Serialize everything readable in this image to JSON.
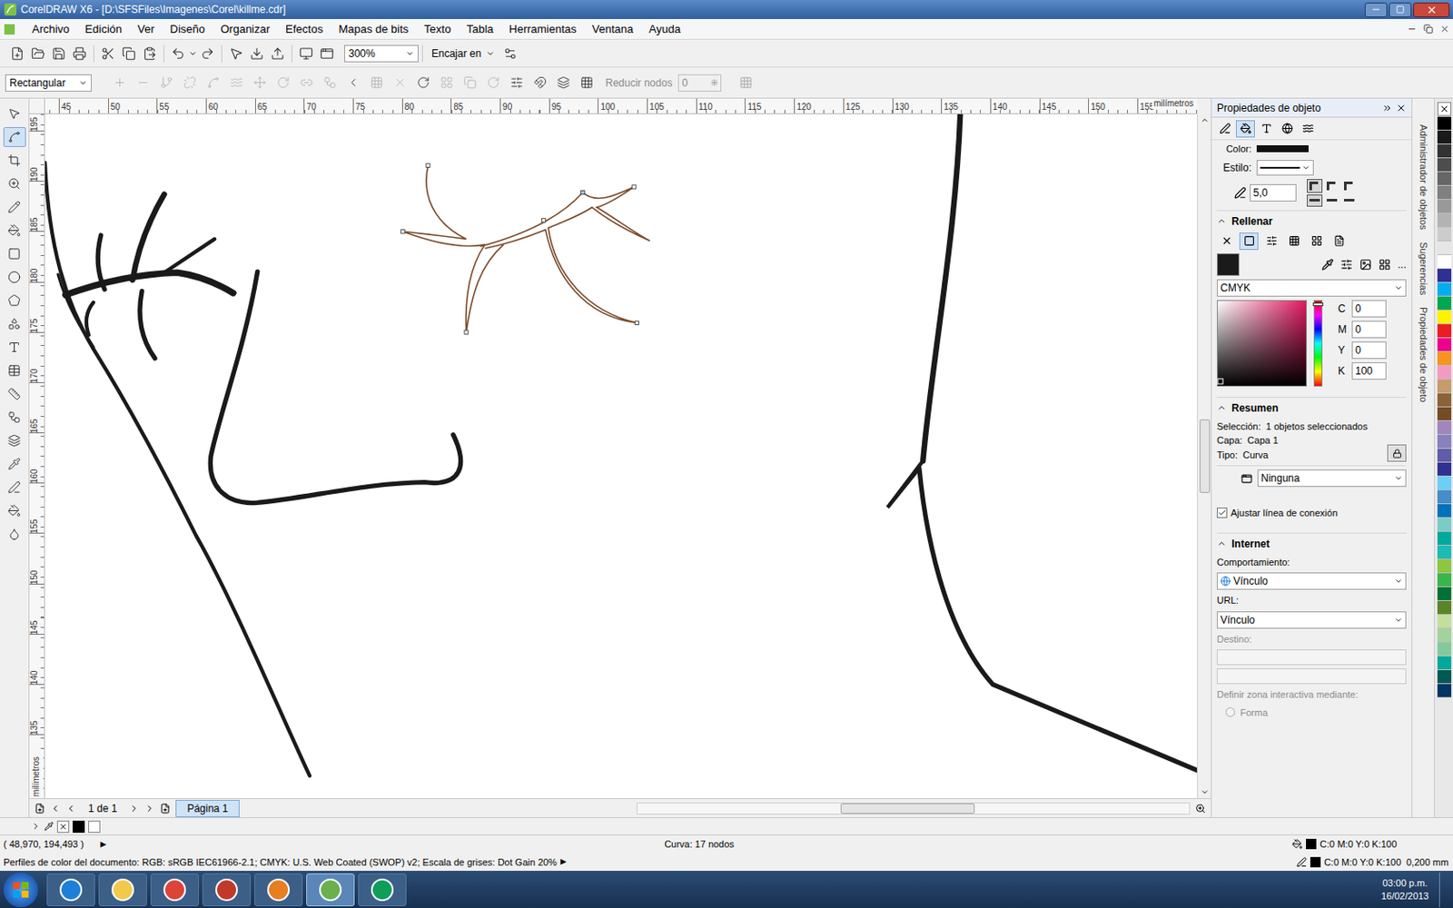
{
  "window": {
    "title": "CorelDRAW X6 - [D:\\SFSFiles\\Imagenes\\Corel\\killme.cdr]"
  },
  "menu": [
    "Archivo",
    "Edición",
    "Ver",
    "Diseño",
    "Organizar",
    "Efectos",
    "Mapas de bits",
    "Texto",
    "Tabla",
    "Herramientas",
    "Ventana",
    "Ayuda"
  ],
  "toolbar": {
    "zoom": "300%",
    "snap": "Encajar en"
  },
  "property_bar": {
    "selection_mode": "Rectangular",
    "reduce_nodes_label": "Reducir nodos",
    "reduce_nodes_value": "0",
    "buttons": [
      {
        "disabled": true
      },
      {
        "disabled": true
      },
      {
        "disabled": true
      },
      {
        "disabled": true
      },
      {
        "disabled": true
      },
      {
        "disabled": true
      },
      {
        "disabled": true
      },
      {
        "disabled": true
      },
      {
        "disabled": true
      },
      {
        "disabled": true
      },
      {
        "disabled": false
      },
      {
        "disabled": true
      },
      {
        "disabled": true
      },
      {
        "disabled": false
      },
      {
        "disabled": true
      },
      {
        "disabled": true
      },
      {
        "disabled": true
      },
      {
        "disabled": false
      },
      {
        "disabled": false
      },
      {
        "disabled": false
      },
      {
        "disabled": false
      }
    ]
  },
  "rulers": {
    "unit": "milímetros",
    "top": [
      "45",
      "50",
      "55",
      "60",
      "65",
      "70",
      "75",
      "80",
      "85",
      "90",
      "95",
      "100",
      "105",
      "110",
      "115",
      "120",
      "125",
      "130",
      "135",
      "140",
      "145",
      "150",
      "155"
    ],
    "left": [
      "195",
      "190",
      "185",
      "180",
      "175",
      "170",
      "165",
      "160",
      "155",
      "150",
      "145",
      "140",
      "135"
    ]
  },
  "toolbox": [
    {
      "kind": "pick",
      "selected": false
    },
    {
      "kind": "shape",
      "selected": true
    },
    {
      "kind": "crop",
      "selected": false
    },
    {
      "kind": "zoom",
      "selected": false
    },
    {
      "kind": "freehand",
      "selected": false
    },
    {
      "kind": "smartfill",
      "selected": false
    },
    {
      "kind": "rectangle",
      "selected": false
    },
    {
      "kind": "ellipse",
      "selected": false
    },
    {
      "kind": "polygon",
      "selected": false
    },
    {
      "kind": "basicshapes",
      "selected": false
    },
    {
      "kind": "text",
      "selected": false
    },
    {
      "kind": "table",
      "selected": false
    },
    {
      "kind": "dimension",
      "selected": false
    },
    {
      "kind": "connector",
      "selected": false
    },
    {
      "kind": "blend",
      "selected": false
    },
    {
      "kind": "eyedropper",
      "selected": false
    },
    {
      "kind": "outline",
      "selected": false
    },
    {
      "kind": "fill",
      "selected": false
    },
    {
      "kind": "interactivefill",
      "selected": false
    }
  ],
  "docker": {
    "title": "Propiedades de objeto",
    "tabs": [
      {
        "kind": "outline",
        "selected": false
      },
      {
        "kind": "fill",
        "selected": true
      },
      {
        "kind": "text",
        "selected": false
      },
      {
        "kind": "internet",
        "selected": false
      },
      {
        "kind": "curve",
        "selected": false
      }
    ],
    "outline": {
      "color_label": "Color:",
      "style_label": "Estilo:",
      "width": "5,0",
      "corners": [
        {
          "selected": true
        },
        {
          "selected": false
        },
        {
          "selected": false
        }
      ],
      "caps": [
        {
          "selected": true
        },
        {
          "selected": false
        },
        {
          "selected": false
        }
      ]
    },
    "fill": {
      "title": "Rellenar",
      "types": [
        {
          "kind": "none",
          "selected": false
        },
        {
          "kind": "uniform",
          "selected": true
        },
        {
          "kind": "fountain",
          "selected": false
        },
        {
          "kind": "pattern",
          "selected": false
        },
        {
          "kind": "texture",
          "selected": false
        },
        {
          "kind": "postscript",
          "selected": false
        }
      ],
      "swatch": "#1a1a1a",
      "model": "CMYK",
      "picker": {
        "x": 0.03,
        "y": 0.93,
        "hue": 0.02
      },
      "values": [
        {
          "label": "C",
          "value": "0"
        },
        {
          "label": "M",
          "value": "0"
        },
        {
          "label": "Y",
          "value": "0"
        },
        {
          "label": "K",
          "value": "100"
        }
      ],
      "more": "..."
    },
    "summary": {
      "title": "Resumen",
      "lines": [
        {
          "label": "Selección:",
          "value": "1 objetos seleccionados"
        },
        {
          "label": "Capa:",
          "value": "Capa 1"
        },
        {
          "label": "Tipo:",
          "value": "Curva"
        }
      ],
      "locked": true
    },
    "wrap": "Ninguna",
    "connector_check": {
      "label": "Ajustar línea de conexión",
      "checked": true
    },
    "internet": {
      "title": "Internet",
      "behavior_label": "Comportamiento:",
      "behavior": "Vínculo",
      "url_label": "URL:",
      "url": "Vínculo",
      "target_label": "Destino:",
      "hotspot_label": "Definir zona interactiva mediante:",
      "options": [
        {
          "label": "Forma",
          "selected": false
        }
      ]
    }
  },
  "side_tabs": [
    "Administrador de objetos",
    "Sugerencias",
    "Propiedades de objeto"
  ],
  "palette": [
    "#000000",
    "#1a1a1a",
    "#333333",
    "#4d4d4d",
    "#666666",
    "#808080",
    "#999999",
    "#b3b3b3",
    "#cccccc",
    "#e6e6e6",
    "#ffffff",
    "#2e3192",
    "#00aeef",
    "#00a651",
    "#fff200",
    "#ed1c24",
    "#ec008c",
    "#f7941d",
    "#f49ac1",
    "#c69c6d",
    "#8c6239",
    "#754c24",
    "#a186be",
    "#8781bd",
    "#605ca8",
    "#2e3192",
    "#6dcff6",
    "#448ccb",
    "#0072bc",
    "#7accc8",
    "#00a99d",
    "#1cbbb4",
    "#8dc63f",
    "#39b54a",
    "#007236",
    "#598527",
    "#c4df9b",
    "#a3d39c",
    "#82ca9c",
    "#00a99d",
    "#005952",
    "#003663"
  ],
  "page_nav": {
    "count": "1 de 1",
    "tab": "Página 1"
  },
  "status": {
    "coords": "( 48,970, 194,493 )",
    "object": "Curva: 17 nodos",
    "profiles": "Perfiles de color del documento: RGB: sRGB IEC61966-2.1; CMYK: U.S. Web Coated (SWOP) v2; Escala de grises: Dot Gain 20%",
    "fill": "C:0 M:0 Y:0 K:100",
    "outline": "C:0 M:0 Y:0 K:100",
    "outline_width": "0,200 mm"
  },
  "taskbar": {
    "time": "03:00 p.m.",
    "date": "16/02/2013",
    "apps": [
      {
        "kind": "ie",
        "selected": false
      },
      {
        "kind": "explorer",
        "selected": false
      },
      {
        "kind": "chrome-user",
        "selected": false
      },
      {
        "kind": "snip",
        "selected": false
      },
      {
        "kind": "media",
        "selected": false
      },
      {
        "kind": "corel",
        "selected": true
      },
      {
        "kind": "chrome",
        "selected": false
      }
    ]
  }
}
